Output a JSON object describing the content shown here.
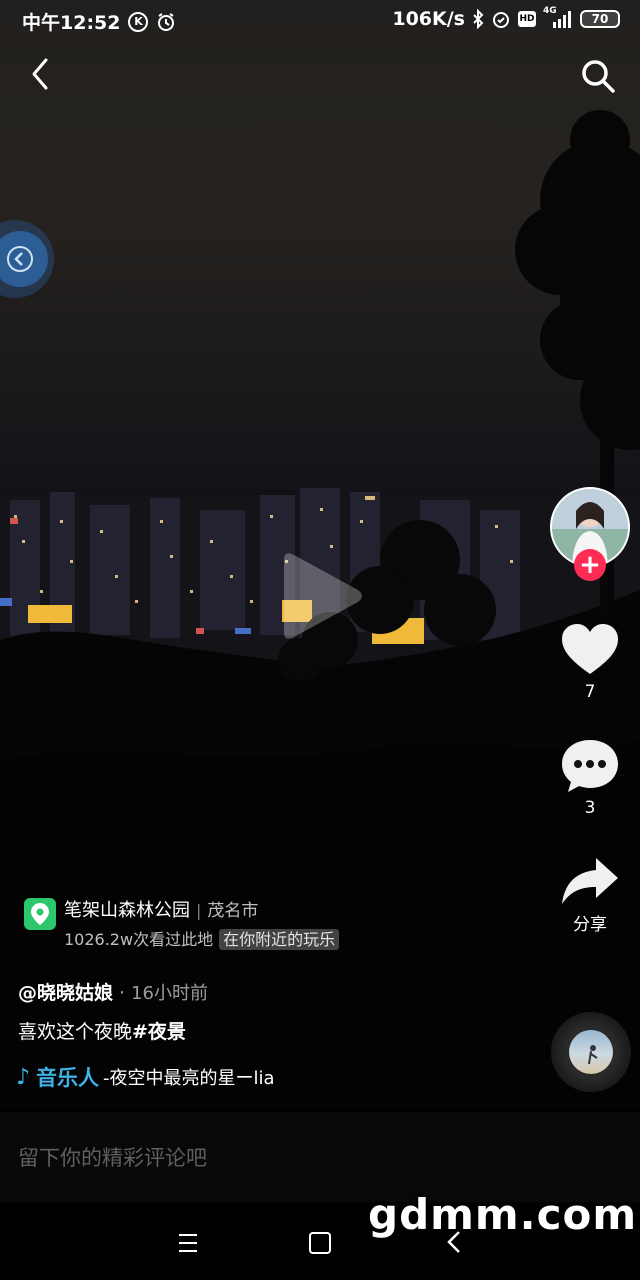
{
  "status_bar": {
    "time": "中午12:52",
    "net_speed": "106K/s",
    "network": "4G",
    "battery": "70"
  },
  "nav": {
    "back_icon": "chevron-left-icon",
    "search_icon": "search-icon"
  },
  "video": {
    "state": "paused"
  },
  "actions": {
    "likes": "7",
    "comments": "3",
    "share_label": "分享"
  },
  "poi": {
    "name": "笔架山森林公园",
    "city": "茂名市",
    "views": "1026.2w次看过此地",
    "tag": "在你附近的玩乐"
  },
  "post": {
    "author": "@晓晓姑娘",
    "time": "16小时前",
    "caption_text": "喜欢这个夜晚",
    "hashtag": "#夜景"
  },
  "music": {
    "artist": "音乐人",
    "title": "-夜空中最亮的星ーlia"
  },
  "comment": {
    "placeholder": "留下你的精彩评论吧"
  },
  "watermark": "gdmm.com",
  "colors": {
    "follow": "#fe2c55",
    "music": "#3fb1e4",
    "poi_icon": "#2dc76d"
  }
}
